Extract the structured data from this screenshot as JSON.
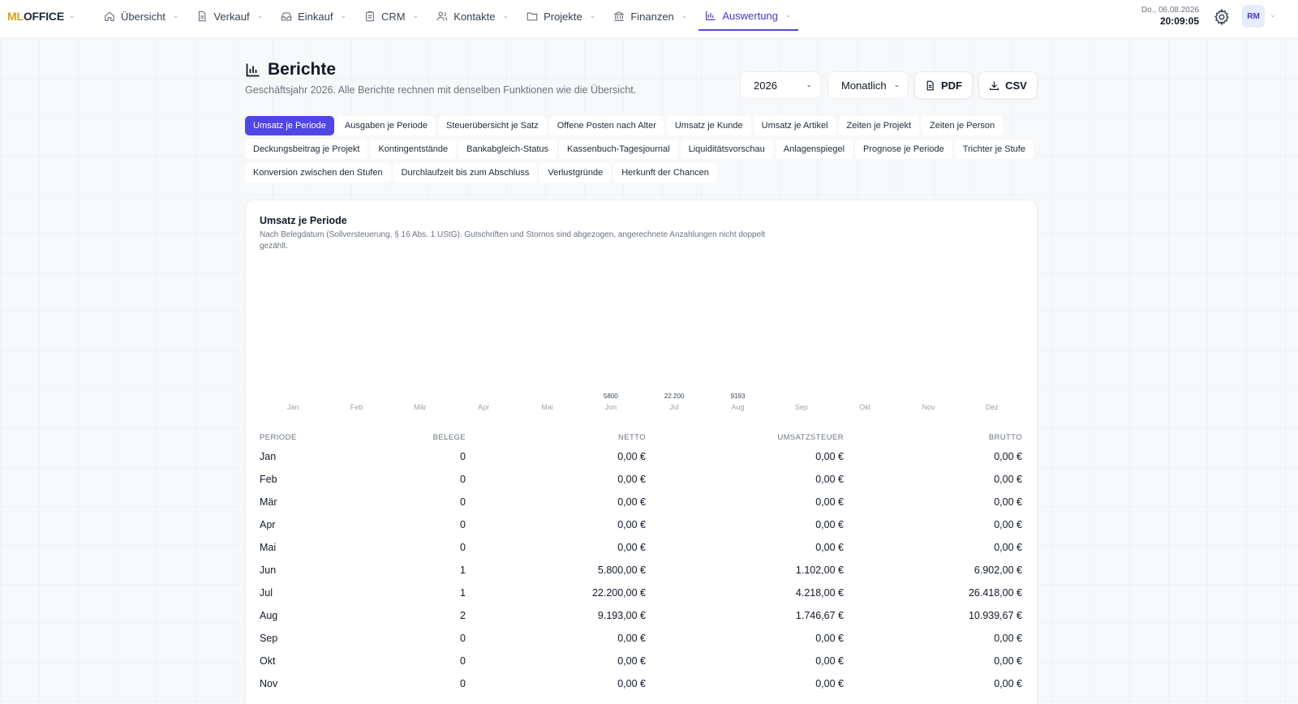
{
  "brand": {
    "ml": "ML",
    "office": "OFFICE"
  },
  "nav": {
    "items": [
      {
        "label": "Übersicht",
        "icon": "home-icon"
      },
      {
        "label": "Verkauf",
        "icon": "document-icon"
      },
      {
        "label": "Einkauf",
        "icon": "inbox-icon"
      },
      {
        "label": "CRM",
        "icon": "clipboard-icon"
      },
      {
        "label": "Kontakte",
        "icon": "users-icon"
      },
      {
        "label": "Projekte",
        "icon": "folder-icon"
      },
      {
        "label": "Finanzen",
        "icon": "bank-icon"
      },
      {
        "label": "Auswertung",
        "icon": "bar-chart-icon",
        "active": true
      }
    ]
  },
  "clock": {
    "date": "Do., 06.08.2026",
    "time": "20:09:05"
  },
  "user": {
    "initials": "RM"
  },
  "page": {
    "title": "Berichte",
    "subtitle": "Geschäftsjahr 2026. Alle Berichte rechnen mit denselben Funktionen wie die Übersicht."
  },
  "controls": {
    "year": "2026",
    "period": "Monatlich",
    "pdf": "PDF",
    "csv": "CSV"
  },
  "tabs": [
    {
      "label": "Umsatz je Periode",
      "active": true
    },
    {
      "label": "Ausgaben je Periode"
    },
    {
      "label": "Steuerübersicht je Satz"
    },
    {
      "label": "Offene Posten nach Alter"
    },
    {
      "label": "Umsatz je Kunde"
    },
    {
      "label": "Umsatz je Artikel"
    },
    {
      "label": "Zeiten je Projekt"
    },
    {
      "label": "Zeiten je Person"
    },
    {
      "label": "Deckungsbeitrag je Projekt"
    },
    {
      "label": "Kontingentstände"
    },
    {
      "label": "Bankabgleich-Status"
    },
    {
      "label": "Kassenbuch-Tagesjournal"
    },
    {
      "label": "Liquiditätsvorschau"
    },
    {
      "label": "Anlagenspiegel"
    },
    {
      "label": "Prognose je Periode"
    },
    {
      "label": "Trichter je Stufe"
    },
    {
      "label": "Konversion zwischen den Stufen"
    },
    {
      "label": "Durchlaufzeit bis zum Abschluss"
    },
    {
      "label": "Verlustgründe"
    },
    {
      "label": "Herkunft der Chancen"
    }
  ],
  "report": {
    "title": "Umsatz je Periode",
    "description": "Nach Belegdatum (Sollversteuerung, § 16 Abs. 1 UStG). Gutschriften und Stornos sind abgezogen, angerechnete Anzahlungen nicht doppelt gezählt."
  },
  "chart_data": {
    "type": "bar",
    "categories": [
      "Jan",
      "Feb",
      "Mär",
      "Apr",
      "Mai",
      "Jun",
      "Jul",
      "Aug",
      "Sep",
      "Okt",
      "Nov",
      "Dez"
    ],
    "values": [
      0,
      0,
      0,
      0,
      0,
      5800,
      22200,
      9193,
      0,
      0,
      0,
      0
    ],
    "value_labels": [
      "",
      "",
      "",
      "",
      "",
      "5800",
      "22.200",
      "9193",
      "",
      "",
      "",
      ""
    ],
    "title": "",
    "xlabel": "",
    "ylabel": "",
    "grid": false
  },
  "table": {
    "headers": [
      "PERIODE",
      "BELEGE",
      "NETTO",
      "UMSATZSTEUER",
      "BRUTTO"
    ],
    "rows": [
      [
        "Jan",
        "0",
        "0,00 €",
        "0,00 €",
        "0,00 €"
      ],
      [
        "Feb",
        "0",
        "0,00 €",
        "0,00 €",
        "0,00 €"
      ],
      [
        "Mär",
        "0",
        "0,00 €",
        "0,00 €",
        "0,00 €"
      ],
      [
        "Apr",
        "0",
        "0,00 €",
        "0,00 €",
        "0,00 €"
      ],
      [
        "Mai",
        "0",
        "0,00 €",
        "0,00 €",
        "0,00 €"
      ],
      [
        "Jun",
        "1",
        "5.800,00 €",
        "1.102,00 €",
        "6.902,00 €"
      ],
      [
        "Jul",
        "1",
        "22.200,00 €",
        "4.218,00 €",
        "26.418,00 €"
      ],
      [
        "Aug",
        "2",
        "9.193,00 €",
        "1.746,67 €",
        "10.939,67 €"
      ],
      [
        "Sep",
        "0",
        "0,00 €",
        "0,00 €",
        "0,00 €"
      ],
      [
        "Okt",
        "0",
        "0,00 €",
        "0,00 €",
        "0,00 €"
      ],
      [
        "Nov",
        "0",
        "0,00 €",
        "0,00 €",
        "0,00 €"
      ]
    ]
  },
  "colors": {
    "accent": "#4f46e5",
    "brand_gold": "#d4a017",
    "muted": "#6b7280"
  }
}
